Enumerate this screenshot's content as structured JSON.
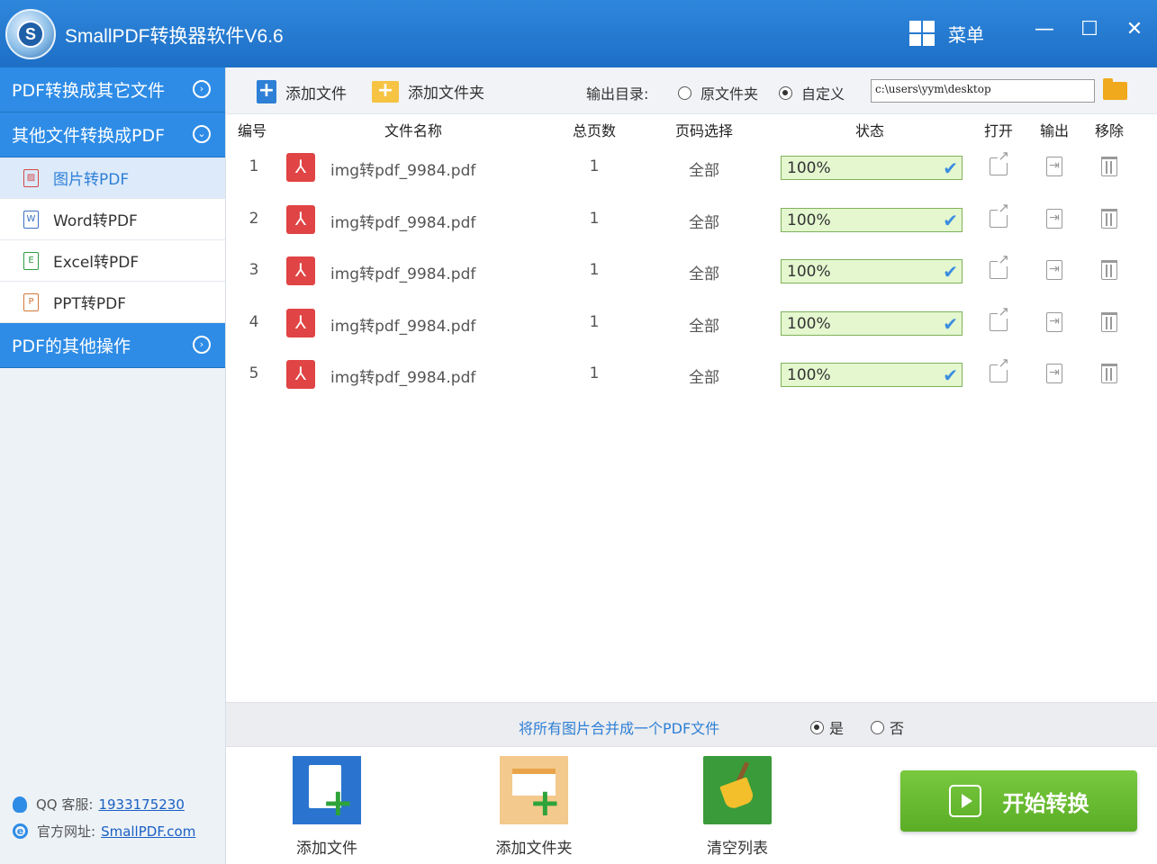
{
  "app": {
    "title": "SmallPDF转换器软件V6.6",
    "logo_letter": "S",
    "menu_label": "菜单"
  },
  "window_controls": {
    "minimize": "—",
    "maximize": "☐",
    "close": "✕"
  },
  "sidebar": {
    "sections": [
      {
        "label": "PDF转换成其它文件",
        "chevron": "›"
      },
      {
        "label": "其他文件转换成PDF",
        "chevron": "⌄"
      },
      {
        "label": "PDF的其他操作",
        "chevron": "›"
      }
    ],
    "items": [
      {
        "label": "图片转PDF",
        "icon": "image-file-icon",
        "glyph": "▨",
        "active": true
      },
      {
        "label": "Word转PDF",
        "icon": "word-file-icon",
        "glyph": "W",
        "active": false
      },
      {
        "label": "Excel转PDF",
        "icon": "excel-file-icon",
        "glyph": "E",
        "active": false
      },
      {
        "label": "PPT转PDF",
        "icon": "ppt-file-icon",
        "glyph": "P",
        "active": false
      }
    ],
    "footer": {
      "qq_label": "QQ 客服:",
      "qq_value": "1933175230",
      "site_label": "官方网址:",
      "site_value": "SmallPDF.com"
    }
  },
  "toolbar": {
    "add_file": "添加文件",
    "add_folder": "添加文件夹",
    "output_label": "输出目录:",
    "opt_original": "原文件夹",
    "opt_custom": "自定义",
    "selected_option": "custom",
    "path_value": "c:\\users\\yym\\desktop"
  },
  "table": {
    "headers": {
      "num": "编号",
      "name": "文件名称",
      "pages": "总页数",
      "range": "页码选择",
      "status": "状态",
      "open": "打开",
      "output": "输出",
      "remove": "移除"
    },
    "rows": [
      {
        "num": "1",
        "name": "img转pdf_9984.pdf",
        "pages": "1",
        "range": "全部",
        "progress": "100%",
        "progress_value": 100
      },
      {
        "num": "2",
        "name": "img转pdf_9984.pdf",
        "pages": "1",
        "range": "全部",
        "progress": "100%",
        "progress_value": 100
      },
      {
        "num": "3",
        "name": "img转pdf_9984.pdf",
        "pages": "1",
        "range": "全部",
        "progress": "100%",
        "progress_value": 100
      },
      {
        "num": "4",
        "name": "img转pdf_9984.pdf",
        "pages": "1",
        "range": "全部",
        "progress": "100%",
        "progress_value": 100
      },
      {
        "num": "5",
        "name": "img转pdf_9984.pdf",
        "pages": "1",
        "range": "全部",
        "progress": "100%",
        "progress_value": 100
      }
    ]
  },
  "merge": {
    "label": "将所有图片合并成一个PDF文件",
    "yes": "是",
    "no": "否",
    "selected": "yes"
  },
  "actions": {
    "add_file": "添加文件",
    "add_folder": "添加文件夹",
    "clear_list": "清空列表",
    "start": "开始转换"
  },
  "colors": {
    "brand_blue": "#2e8ce6",
    "progress_bg": "#e4f7cf",
    "start_green": "#5aad25",
    "pdf_red": "#e04444"
  }
}
